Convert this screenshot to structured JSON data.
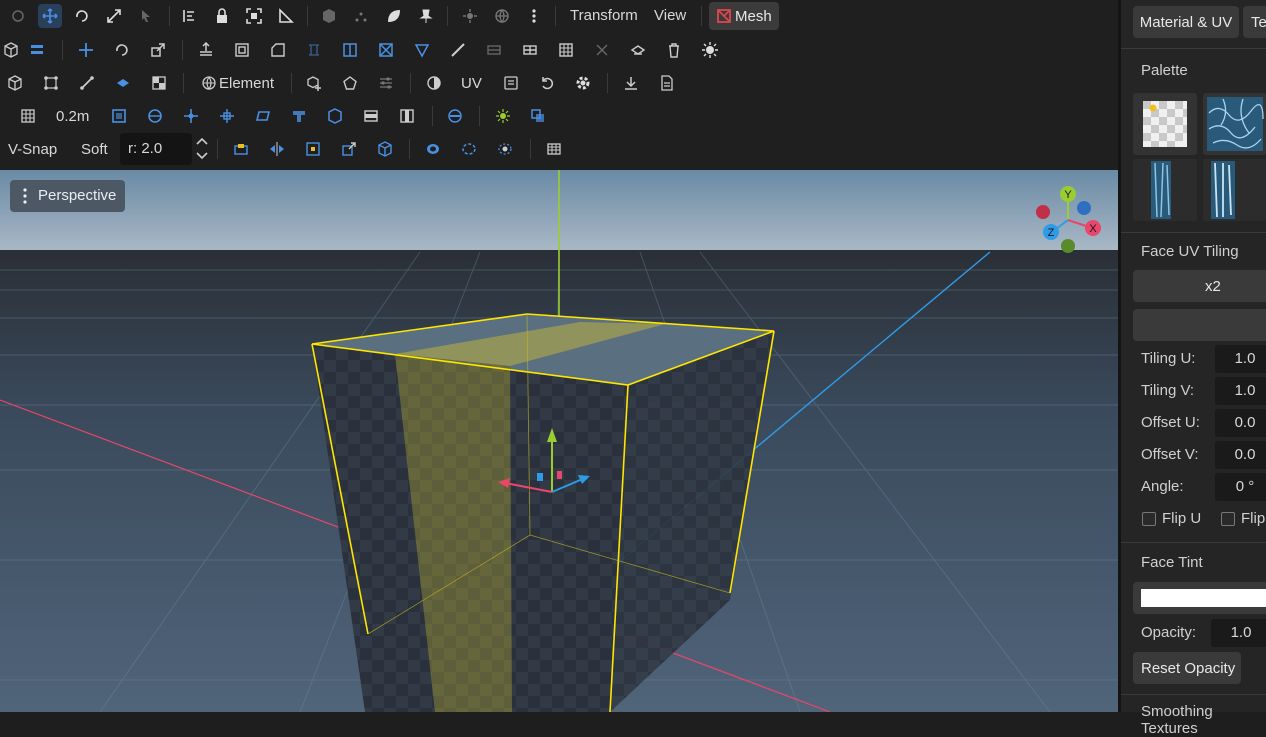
{
  "toolbar": {
    "menu_transform": "Transform",
    "menu_view": "View",
    "mode_mesh": "Mesh",
    "element_label": "Element",
    "uv_label": "UV",
    "grid_size": "0.2m",
    "vsnap_label": "V-Snap",
    "soft_label": "Soft",
    "radius_value": "r: 2.0"
  },
  "viewport": {
    "camera_label": "Perspective",
    "gizmo_labels": {
      "y": "Y",
      "x": "X",
      "z": "Z"
    }
  },
  "panel": {
    "tab_material": "Material & UV",
    "tab_second": "Te",
    "palette_title": "Palette",
    "face_uv_tiling_title": "Face UV Tiling",
    "x2_button": "x2",
    "tiling_u_label": "Tiling U:",
    "tiling_u_value": "1.0",
    "tiling_v_label": "Tiling V:",
    "tiling_v_value": "1.0",
    "offset_u_label": "Offset U:",
    "offset_u_value": "0.0",
    "offset_v_label": "Offset V:",
    "offset_v_value": "0.0",
    "angle_label": "Angle:",
    "angle_value": "0 °",
    "flip_u_label": "Flip U",
    "flip_v_label": "Flip",
    "face_tint_title": "Face Tint",
    "tint_color": "#ffffff",
    "opacity_label": "Opacity:",
    "opacity_value": "1.0",
    "reset_opacity_label": "Reset Opacity",
    "bottom_title": "Smoothing Textures"
  },
  "colors": {
    "accent": "#4a90e2",
    "selection": "#ffe600",
    "axis_x": "#e8466a",
    "axis_y": "#9acd32",
    "axis_z": "#2e9be8",
    "mesh_icon": "#e0464e"
  }
}
